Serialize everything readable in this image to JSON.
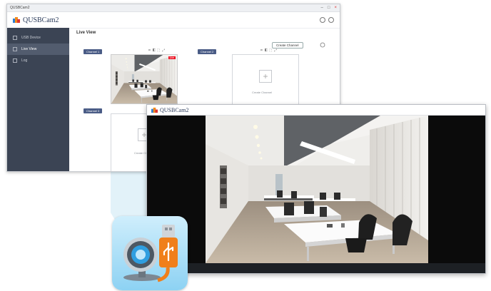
{
  "back_window": {
    "titlebar_text": "QUSBCam2",
    "controls": [
      "–",
      "□",
      "×"
    ],
    "brand_name": "QUSBCam2",
    "sidebar": {
      "items": [
        {
          "label": "USB Device",
          "icon": "usb-device-icon",
          "active": false
        },
        {
          "label": "Live View",
          "icon": "live-view-icon",
          "active": true
        },
        {
          "label": "Log",
          "icon": "log-icon",
          "active": false
        }
      ]
    },
    "page_title": "Live View",
    "create_channel_label": "Create Channel",
    "channels": [
      {
        "tag": "Channel 1",
        "live_badge": "Live"
      },
      {
        "tag": "Channel 2",
        "caption": "Create Channel"
      },
      {
        "tag": "Channel 3",
        "caption": "Create Ch"
      }
    ],
    "colors": {
      "sidebar": "#3b4454",
      "tag": "#4a5c86",
      "live": "#e12222"
    }
  },
  "viewer_window": {
    "brand_name": "QUSBCam2"
  },
  "app_icon": {
    "name": "webcam-usb-app-icon",
    "colors": {
      "background": "#a8def7",
      "usb_plug": "#f07f1a",
      "lens": "#2f9ee0"
    }
  }
}
